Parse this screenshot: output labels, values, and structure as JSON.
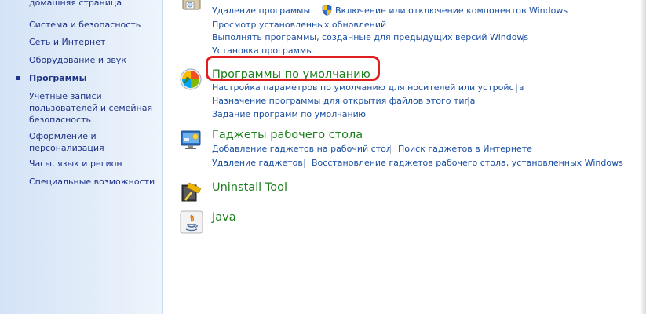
{
  "sidebar": {
    "items": [
      {
        "label": "домашняя страница"
      },
      {
        "label": "Система и безопасность"
      },
      {
        "label": "Сеть и Интернет"
      },
      {
        "label": "Оборудование и звук"
      },
      {
        "label": "Программы",
        "active": true
      },
      {
        "label": "Учетные записи пользователей и семейная безопасность"
      },
      {
        "label": "Оформление и персонализация"
      },
      {
        "label": "Часы, язык и регион"
      },
      {
        "label": "Специальные возможности"
      }
    ]
  },
  "categories": [
    {
      "title": "",
      "icon": "programs-box-icon",
      "links": [
        "Удаление программы",
        "Включение или отключение компонентов Windows",
        "Просмотр установленных обновлений",
        "Выполнять программы, созданные для предыдущих версий Windows",
        "Установка программы"
      ]
    },
    {
      "title": "Программы по умолчанию",
      "icon": "default-programs-icon",
      "links": [
        "Настройка параметров по умолчанию для носителей или устройств",
        "Назначение программы для открытия файлов этого типа",
        "Задание программ по умолчанию"
      ]
    },
    {
      "title": "Гаджеты рабочего стола",
      "icon": "desktop-gadgets-icon",
      "links": [
        "Добавление гаджетов на рабочий стол",
        "Поиск гаджетов в Интернете",
        "Удаление гаджетов",
        "Восстановление гаджетов рабочего стола, установленных Windows"
      ]
    },
    {
      "title": "Uninstall Tool",
      "icon": "uninstall-tool-icon",
      "links": []
    },
    {
      "title": "Java",
      "icon": "java-icon",
      "links": []
    }
  ],
  "colors": {
    "link": "#1a4fa0",
    "category_title": "#1d7f1d",
    "highlight": "#e0201e"
  }
}
